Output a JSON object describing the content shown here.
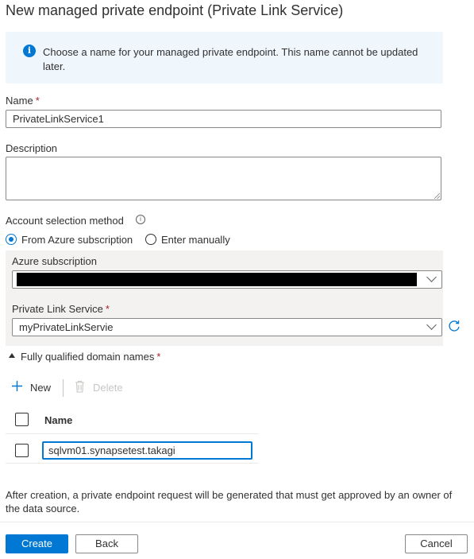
{
  "title": "New managed private endpoint (Private Link Service)",
  "info": {
    "icon": "info-icon",
    "text": "Choose a name for your managed private endpoint. This name cannot be updated later."
  },
  "name_field": {
    "label": "Name",
    "required": "*",
    "value": "PrivateLinkService1"
  },
  "description_field": {
    "label": "Description",
    "value": ""
  },
  "account_selection": {
    "label": "Account selection method",
    "info_glyph": "i",
    "options": [
      {
        "label": "From Azure subscription",
        "selected": true
      },
      {
        "label": "Enter manually",
        "selected": false
      }
    ]
  },
  "azure_subscription": {
    "label": "Azure subscription",
    "value": ""
  },
  "private_link_service": {
    "label": "Private Link Service",
    "required": "*",
    "value": "myPrivateLinkServie"
  },
  "fqdn": {
    "section_label": "Fully qualified domain names",
    "required": "*",
    "new_label": "New",
    "delete_label": "Delete",
    "column_header": "Name",
    "rows": [
      {
        "value": "sqlvm01.synapsetest.takagi"
      }
    ]
  },
  "footer_text": "After creation, a private endpoint request will be generated that must get approved by an owner of the data source.",
  "buttons": {
    "create": "Create",
    "back": "Back",
    "cancel": "Cancel"
  },
  "colors": {
    "accent": "#0078d4",
    "info_bg": "#eff6fc",
    "required": "#a4262c",
    "panel_bg": "#f3f2f1"
  }
}
